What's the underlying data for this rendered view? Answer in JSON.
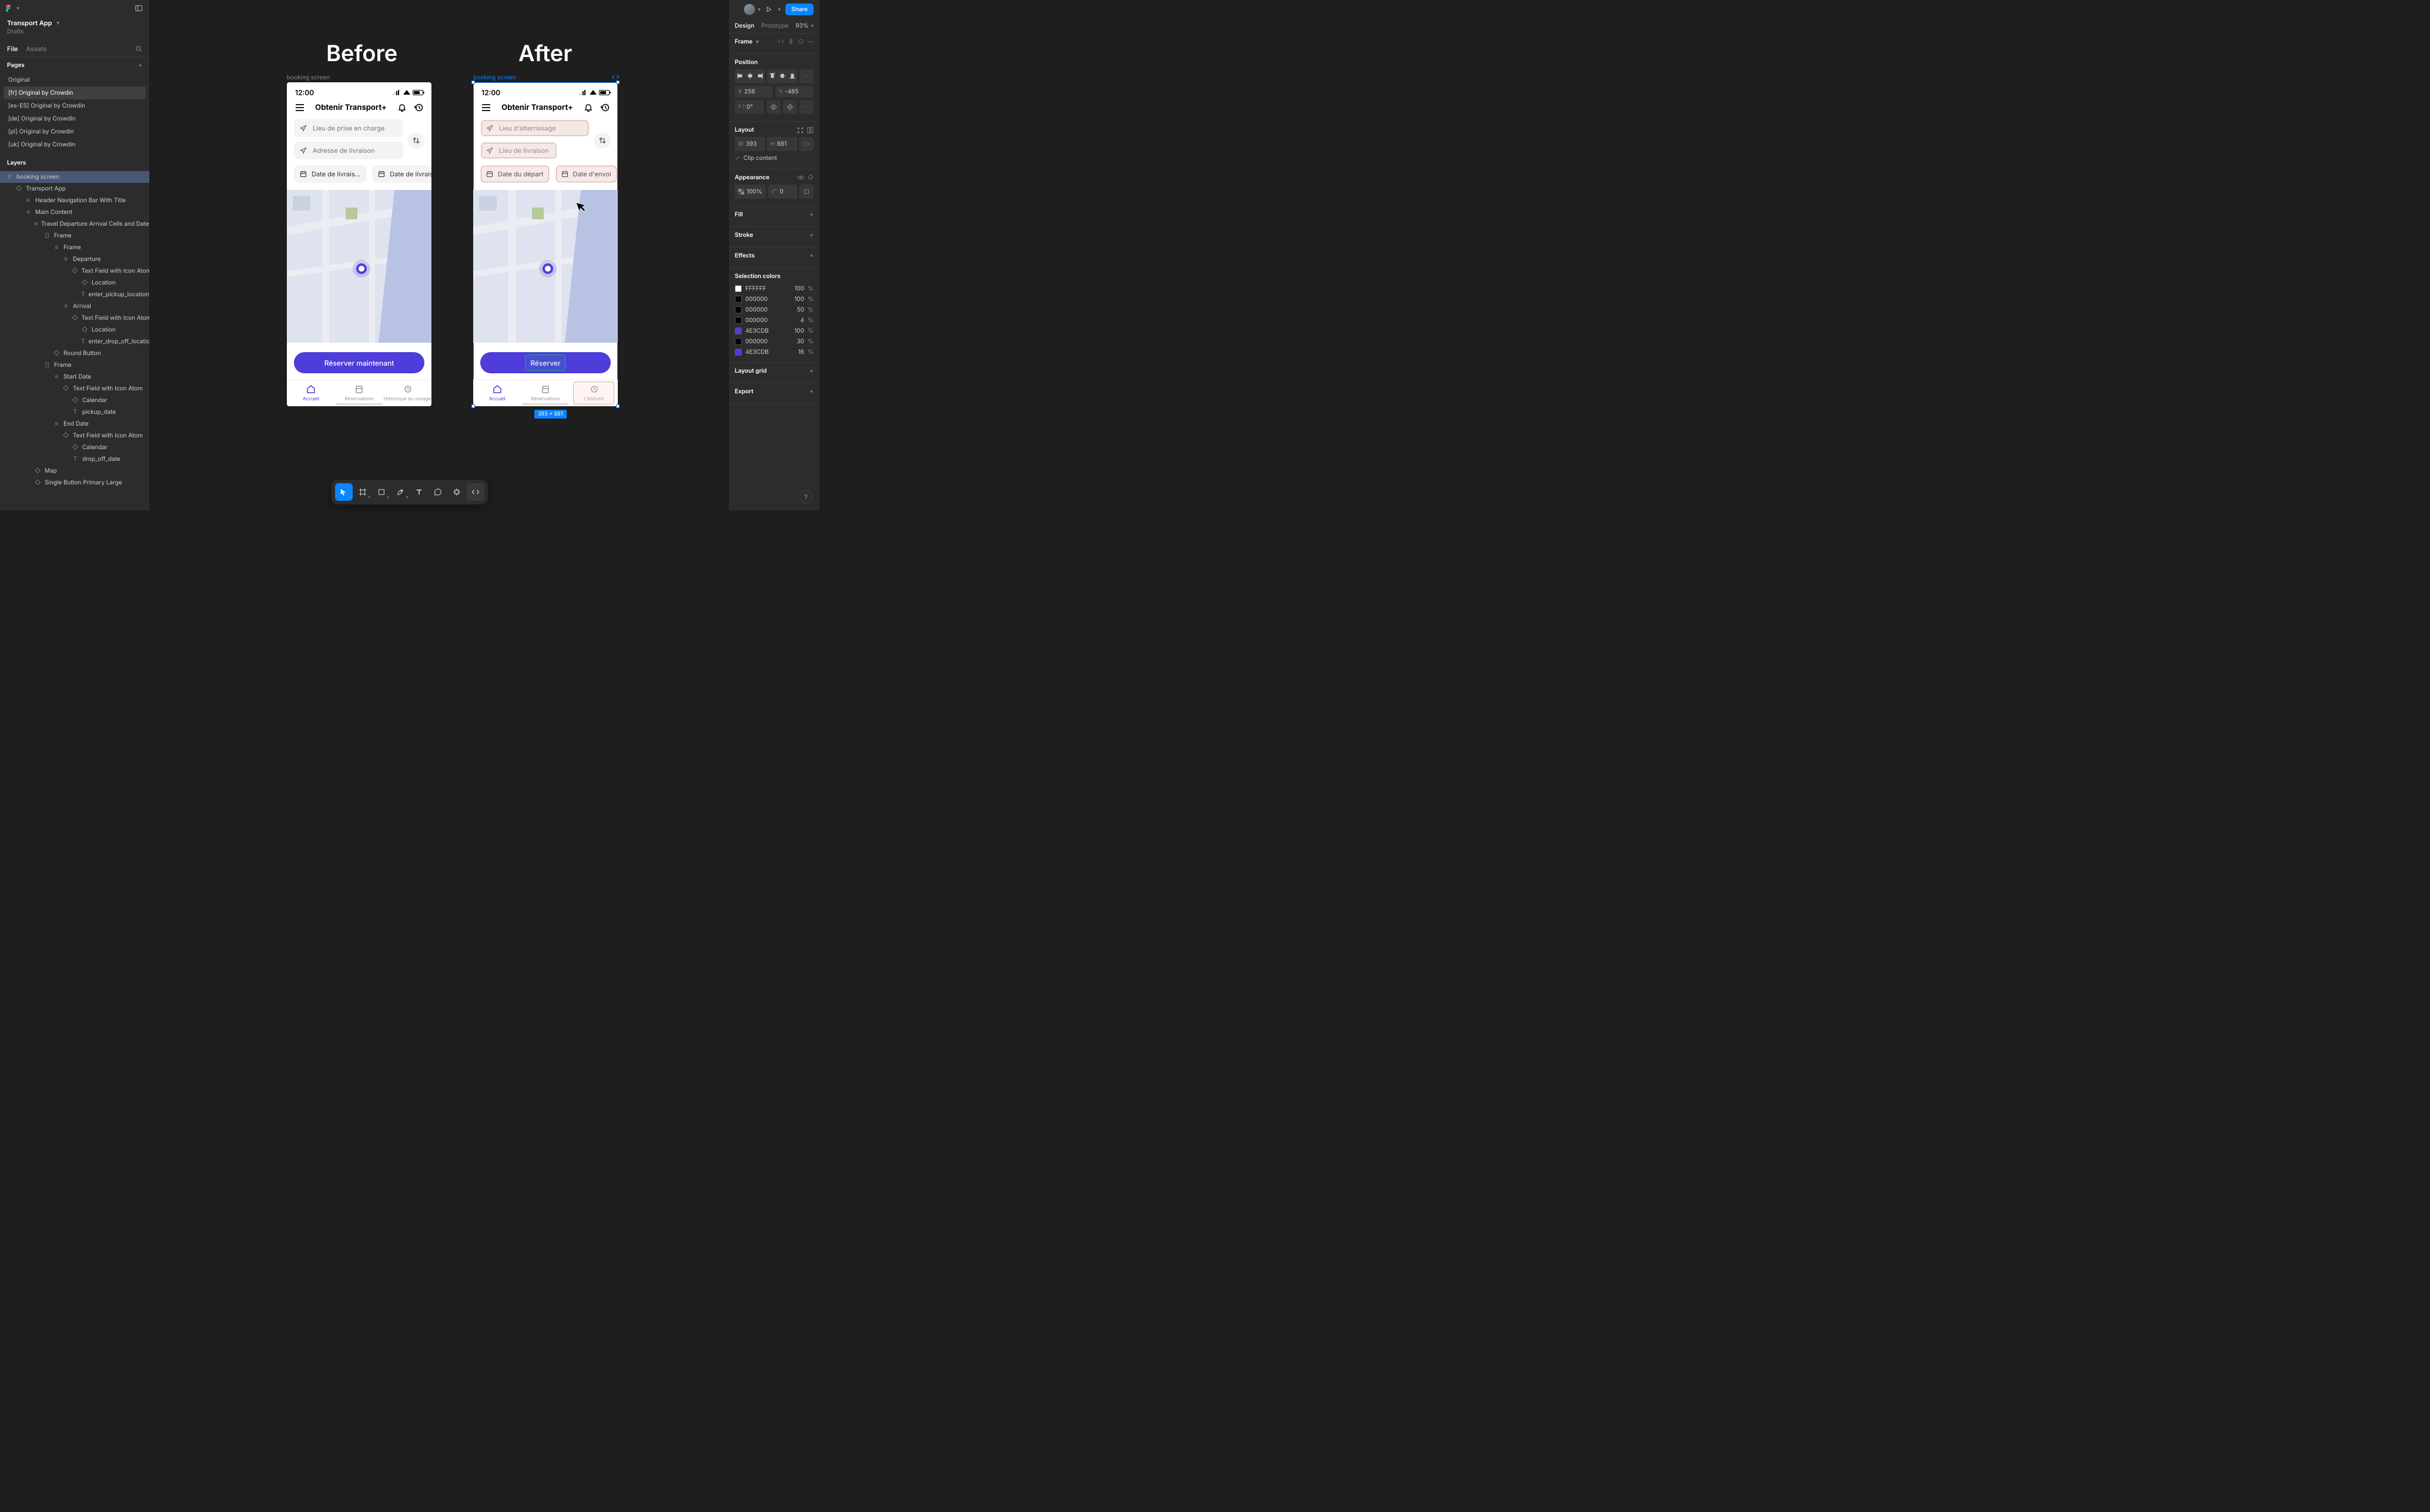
{
  "app": {
    "title": "Transport App",
    "subtitle": "Drafts"
  },
  "left_tabs": {
    "file": "File",
    "assets": "Assets"
  },
  "sections": {
    "pages": "Pages",
    "layers": "Layers"
  },
  "pages": [
    {
      "label": "Original",
      "selected": false
    },
    {
      "label": "[fr] Original by Crowdin",
      "selected": true
    },
    {
      "label": "[es-ES] Original by Crowdin",
      "selected": false
    },
    {
      "label": "[de] Original by Crowdin",
      "selected": false
    },
    {
      "label": "[pl] Original by Crowdin",
      "selected": false
    },
    {
      "label": "[uk] Original by Crowdin",
      "selected": false
    }
  ],
  "layers": [
    {
      "d": 0,
      "i": "#",
      "t": "booking screen",
      "sel": true
    },
    {
      "d": 1,
      "i": "◇",
      "t": "Transport App"
    },
    {
      "d": 2,
      "i": "≡",
      "t": "Header Navigation Bar With Title"
    },
    {
      "d": 2,
      "i": "≡",
      "t": "Main Content"
    },
    {
      "d": 3,
      "i": "≡",
      "t": "Travel Departure Arrival Cells and Date Span"
    },
    {
      "d": 4,
      "i": "[]",
      "t": "Frame"
    },
    {
      "d": 5,
      "i": "≡",
      "t": "Frame"
    },
    {
      "d": 6,
      "i": "≡",
      "t": "Departure"
    },
    {
      "d": 7,
      "i": "◇",
      "t": "Text Field with Icon Atom"
    },
    {
      "d": 8,
      "i": "◇",
      "t": "Location"
    },
    {
      "d": 8,
      "i": "T",
      "t": "enter_pickup_location"
    },
    {
      "d": 6,
      "i": "≡",
      "t": "Arrival"
    },
    {
      "d": 7,
      "i": "◇",
      "t": "Text Field with Icon Atom"
    },
    {
      "d": 8,
      "i": "◇",
      "t": "Location"
    },
    {
      "d": 8,
      "i": "T",
      "t": "enter_drop_off_location"
    },
    {
      "d": 5,
      "i": "◇",
      "t": "Round Button"
    },
    {
      "d": 4,
      "i": "[]",
      "t": "Frame"
    },
    {
      "d": 5,
      "i": "≡",
      "t": "Start Date"
    },
    {
      "d": 6,
      "i": "◇",
      "t": "Text Field with Icon Atom"
    },
    {
      "d": 7,
      "i": "◇",
      "t": "Calendar"
    },
    {
      "d": 7,
      "i": "T",
      "t": "pickup_date"
    },
    {
      "d": 5,
      "i": "≡",
      "t": "End Date"
    },
    {
      "d": 6,
      "i": "◇",
      "t": "Text Field with Icon Atom"
    },
    {
      "d": 7,
      "i": "◇",
      "t": "Calendar"
    },
    {
      "d": 7,
      "i": "T",
      "t": "drop_off_date"
    },
    {
      "d": 3,
      "i": "◇",
      "t": "Map"
    },
    {
      "d": 3,
      "i": "◇",
      "t": "Single Button Primary Large"
    }
  ],
  "canvas": {
    "before_heading": "Before",
    "after_heading": "After",
    "frame_label_before": "booking screen",
    "frame_label_after": "booking screen",
    "selection_size": "393 × 881"
  },
  "phone": {
    "time": "12:00",
    "nav_title": "Obtenir Transport+",
    "before": {
      "pickup": "Lieu de prise en charge",
      "dropoff": "Adresse de livraison",
      "date1": "Date de livrais…",
      "date2": "Date de livrais…",
      "cta": "Réserver maintenant",
      "nav": [
        "Accueil",
        "Réservations",
        "Historique du voyage"
      ]
    },
    "after": {
      "pickup": "Lieu d'atterrissage",
      "dropoff": "Lieu de livraison",
      "date1": "Date du départ",
      "date2": "Date d'envoi",
      "cta": "Réserver",
      "nav": [
        "Accueil",
        "Réservations",
        "L'histoire"
      ]
    }
  },
  "right": {
    "share": "Share",
    "tabs": {
      "design": "Design",
      "prototype": "Prototype"
    },
    "zoom": "93%",
    "frame_section": "Frame",
    "position_section": "Position",
    "x": "256",
    "y": "-485",
    "rot": "0°",
    "layout_section": "Layout",
    "w": "393",
    "h": "881",
    "clip": "Clip content",
    "appearance_section": "Appearance",
    "opacity": "100%",
    "radius": "0",
    "fill_section": "Fill",
    "stroke_section": "Stroke",
    "effects_section": "Effects",
    "sel_colors_section": "Selection colors",
    "colors": [
      {
        "hex": "FFFFFF",
        "pct": "100",
        "sw": "#ffffff"
      },
      {
        "hex": "000000",
        "pct": "100",
        "sw": "#000000"
      },
      {
        "hex": "000000",
        "pct": "50",
        "sw": "#000000"
      },
      {
        "hex": "000000",
        "pct": "4",
        "sw": "#000000"
      },
      {
        "hex": "4E3CDB",
        "pct": "100",
        "sw": "#4e3cdb"
      },
      {
        "hex": "000000",
        "pct": "30",
        "sw": "#000000"
      },
      {
        "hex": "4E3CDB",
        "pct": "16",
        "sw": "#4e3cdb"
      }
    ],
    "layout_grid_section": "Layout grid",
    "export_section": "Export"
  }
}
